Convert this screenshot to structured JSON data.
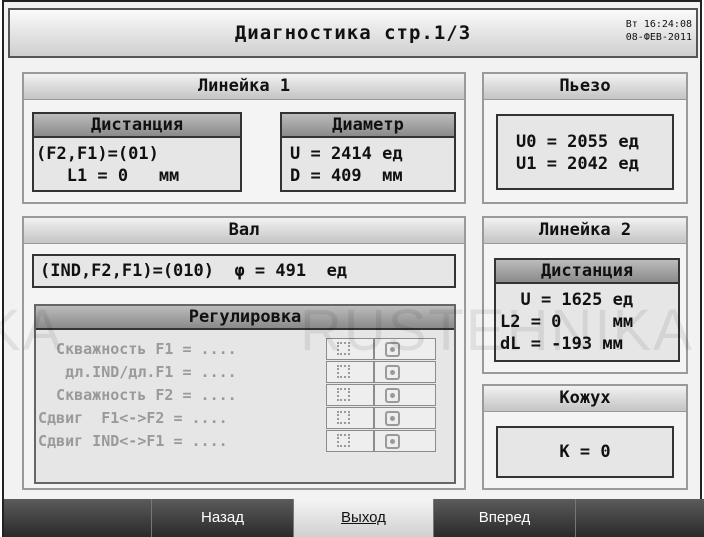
{
  "header": {
    "title": "Диагностика стр.1/3",
    "datetime_line1": "Вт 16:24:08",
    "datetime_line2": "08-ФЕВ-2011"
  },
  "lineika1": {
    "title": "Линейка 1",
    "distance": {
      "title": "Дистанция",
      "line1": "(F2,F1)=(01)",
      "line2": "   L1 = 0   мм"
    },
    "diameter": {
      "title": "Диаметр",
      "line1": "U = 2414 ед",
      "line2": "D = 409  мм"
    }
  },
  "piezo": {
    "title": "Пьезо",
    "line1": "U0 = 2055 ед",
    "line2": "U1 = 2042 ед"
  },
  "val": {
    "title": "Вал",
    "value_line": "(IND,F2,F1)=(010)  φ = 491  ед",
    "regulation": {
      "title": "Регулировка",
      "rows": [
        "  Скважность F1 = ....",
        "   дл.IND/дл.F1 = ....",
        "  Скважность F2 = ....",
        "Сдвиг  F1<->F2 = ....",
        "Сдвиг IND<->F1 = ...."
      ]
    }
  },
  "lineika2": {
    "title": "Линейка 2",
    "distance": {
      "title": "Дистанция",
      "line1": "  U = 1625 ед",
      "line2": "L2 = 0     мм",
      "line3": "dL = -193 мм"
    }
  },
  "kozhukh": {
    "title": "Кожух",
    "value": "K = 0"
  },
  "footer": {
    "back": "Назад",
    "exit": "Выход",
    "forward": "Вперед"
  },
  "watermark": {
    "left": "KA",
    "right": "RUSTEHNIKA"
  }
}
